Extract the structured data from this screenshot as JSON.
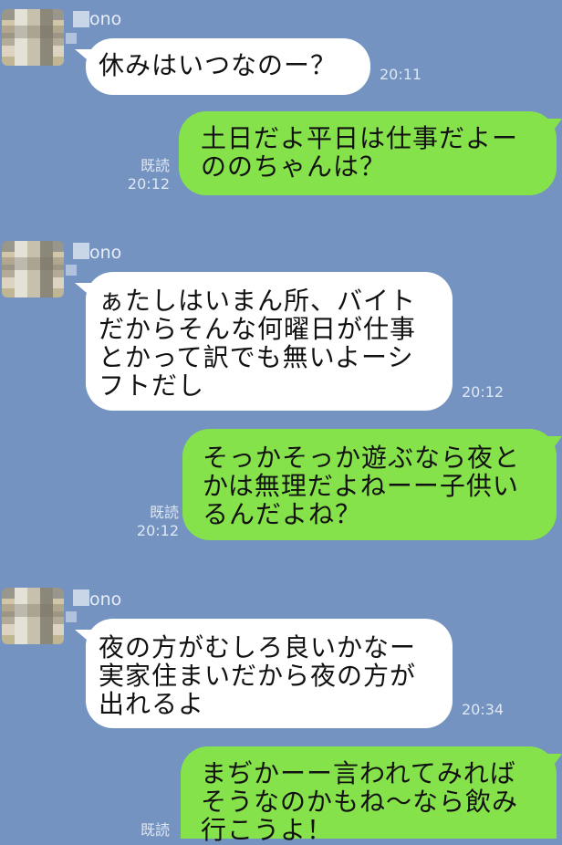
{
  "colors": {
    "background": "#7493c0",
    "incoming_bubble": "#ffffff",
    "outgoing_bubble": "#86e24b"
  },
  "chat": {
    "groups": [
      {
        "sender": "ono"
      },
      {
        "sender": "ono"
      },
      {
        "sender": "ono"
      }
    ],
    "messages": [
      {
        "direction": "incoming",
        "text": "休みはいつなのー？",
        "time": "20:11"
      },
      {
        "direction": "outgoing",
        "text": "土日だよ平日は仕事だよー\nののちゃんは？",
        "read": "既読",
        "time": "20:12"
      },
      {
        "direction": "incoming",
        "text": "ぁたしはいまん所、バイト\nだからそんな何曜日が仕事\nとかって訳でも無いよーシ\nフトだし",
        "time": "20:12"
      },
      {
        "direction": "outgoing",
        "text": "そっかそっか遊ぶなら夜と\nかは無理だよねーー子供い\nるんだよね？",
        "read": "既読",
        "time": "20:12"
      },
      {
        "direction": "incoming",
        "text": "夜の方がむしろ良いかなー\n実家住まいだから夜の方が\n出れるよ",
        "time": "20:34"
      },
      {
        "direction": "outgoing",
        "text": "まぢかーー言われてみれば\nそうなのかもね〜なら飲み\n行こうよ！",
        "read": "既読",
        "time": ""
      }
    ]
  }
}
